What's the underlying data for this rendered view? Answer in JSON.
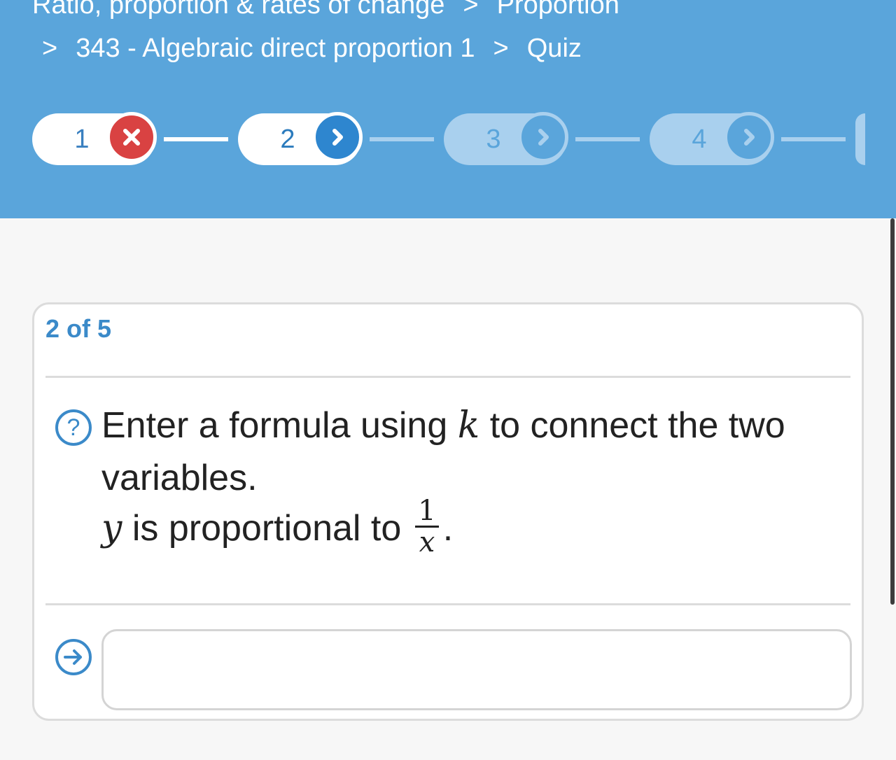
{
  "breadcrumb": {
    "line1": [
      "Ratio, proportion & rates of change",
      "Proportion"
    ],
    "line2": [
      "343 - Algebraic direct proportion 1",
      "Quiz"
    ],
    "separator": ">"
  },
  "steps": [
    {
      "number": "1",
      "state": "wrong",
      "icon": "close-icon"
    },
    {
      "number": "2",
      "state": "current",
      "icon": "chevron-right-icon"
    },
    {
      "number": "3",
      "state": "pending",
      "icon": "chevron-right-icon"
    },
    {
      "number": "4",
      "state": "pending",
      "icon": "chevron-right-icon"
    }
  ],
  "question": {
    "counter": "2 of 5",
    "text_before": "Enter a formula using",
    "var_k": "k",
    "text_after": "to connect the two variables.",
    "var_y": "y",
    "relation": "is proportional to",
    "frac_num": "1",
    "frac_den": "x",
    "period": "."
  },
  "answer": {
    "value": "",
    "placeholder": ""
  },
  "colors": {
    "header": "#5aa5db",
    "accent": "#3b8ac9",
    "wrong": "#d94242"
  }
}
